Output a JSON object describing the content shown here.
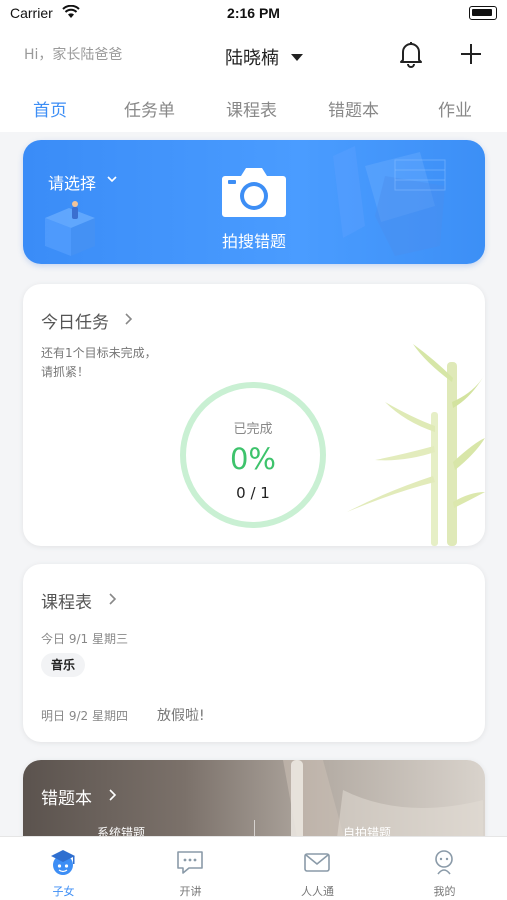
{
  "status_bar": {
    "carrier": "Carrier",
    "time": "2:16 PM"
  },
  "header": {
    "greeting": "Hi，家长陆爸爸",
    "child_name": "陆晓楠"
  },
  "tabs": [
    {
      "label": "首页",
      "active": true
    },
    {
      "label": "任务单",
      "active": false
    },
    {
      "label": "课程表",
      "active": false
    },
    {
      "label": "错题本",
      "active": false
    },
    {
      "label": "作业",
      "active": false
    }
  ],
  "camera_card": {
    "select_label": "请选择",
    "action_label": "拍搜错题"
  },
  "today_tasks": {
    "title": "今日任务",
    "hint_line1": "还有1个目标未完成，",
    "hint_line2": "请抓紧！",
    "ring_label": "已完成",
    "percent": "0%",
    "count": "0 / 1"
  },
  "schedule": {
    "title": "课程表",
    "today": "今日 9/1 星期三",
    "subject": "音乐",
    "tomorrow": "明日 9/2 星期四",
    "holiday": "放假啦!"
  },
  "wrong_book": {
    "title": "错题本",
    "left_label": "系统错题",
    "right_label": "自拍错题"
  },
  "bottom_nav": [
    {
      "label": "子女",
      "icon": "graduate-icon",
      "active": true
    },
    {
      "label": "开讲",
      "icon": "chat-bubble-icon",
      "active": false
    },
    {
      "label": "人人通",
      "icon": "mail-icon",
      "active": false
    },
    {
      "label": "我的",
      "icon": "profile-icon",
      "active": false
    }
  ],
  "colors": {
    "accent": "#3d8ef5",
    "progress_green": "#3ec36c"
  }
}
